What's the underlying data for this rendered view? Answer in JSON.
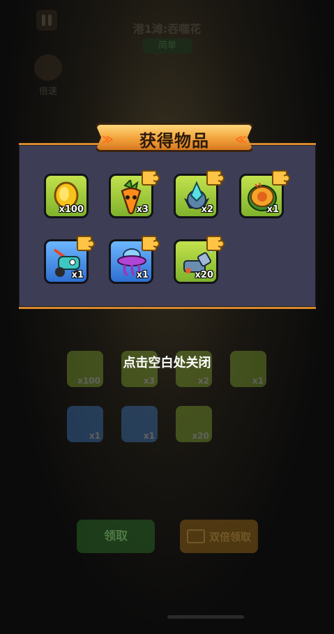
{
  "header": {
    "level_title": "港1滩:吞噬花",
    "level_sub": "简单",
    "speed_label": "倍速"
  },
  "popup": {
    "title": "获得物品",
    "items": [
      {
        "name": "gold-coin",
        "qty": "x100",
        "frame": "green",
        "piece": false
      },
      {
        "name": "carrot-hero",
        "qty": "x3",
        "frame": "green",
        "piece": true
      },
      {
        "name": "crystal-turret",
        "qty": "x2",
        "frame": "green",
        "piece": true
      },
      {
        "name": "pizza-shield",
        "qty": "x1",
        "frame": "green",
        "piece": true
      },
      {
        "name": "lawnmower-robot",
        "qty": "x1",
        "frame": "blue",
        "piece": true
      },
      {
        "name": "purple-ufo",
        "qty": "x1",
        "frame": "blue",
        "piece": true
      },
      {
        "name": "water-cannon",
        "qty": "x20",
        "frame": "green",
        "piece": true
      }
    ]
  },
  "hint": "点击空白处关闭",
  "background": {
    "ghost_qtys": [
      "x100",
      "x3",
      "x2",
      "x1",
      "x1",
      "x1",
      "x20"
    ],
    "claim_button": "领取",
    "double_claim_button": "双倍领取"
  },
  "colors": {
    "panel": "#3d3d55",
    "border": "#d98a2c",
    "green_frame": "#9ccc3a",
    "blue_frame": "#4a95f0",
    "puzzle_piece": "#ffc445"
  }
}
